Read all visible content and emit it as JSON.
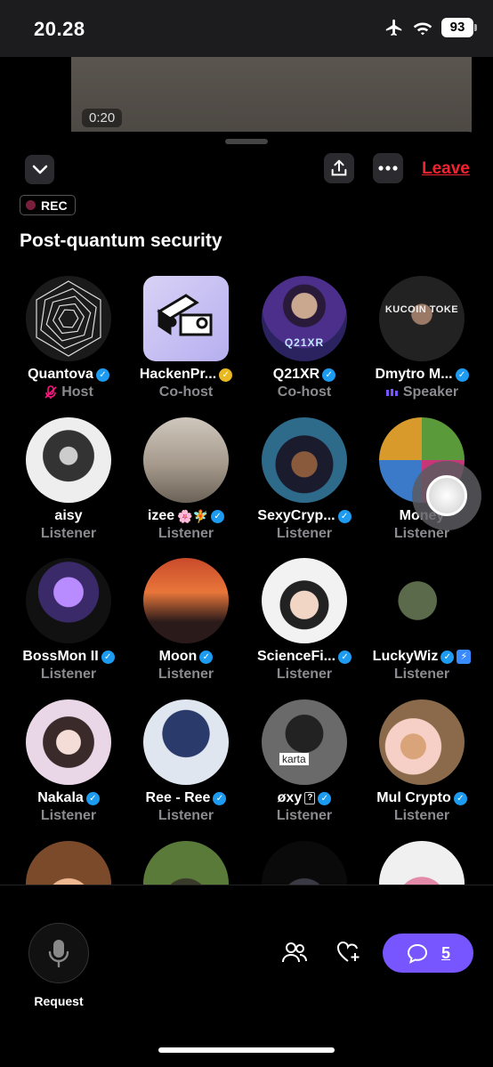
{
  "status_bar": {
    "time": "20.28",
    "battery": "93"
  },
  "video": {
    "time": "0:20"
  },
  "header": {
    "leave_label": "Leave",
    "rec_label": "REC"
  },
  "space": {
    "title": "Post-quantum security"
  },
  "participants": [
    {
      "name": "Quantova",
      "role": "Host",
      "verified": "blue",
      "role_icon": "muted-mic-icon"
    },
    {
      "name": "HackenPr...",
      "role": "Co-host",
      "verified": "gold"
    },
    {
      "name": "Q21XR",
      "role": "Co-host",
      "verified": "blue",
      "avatar_text": "Q21XR"
    },
    {
      "name": "Dmytro M...",
      "role": "Speaker",
      "verified": "blue",
      "role_icon": "speaking-bars-icon",
      "avatar_text": "KUCOIN TOKE"
    },
    {
      "name": "aisy",
      "role": "Listener"
    },
    {
      "name": "izee",
      "role": "Listener",
      "verified": "blue",
      "name_suffix": "🌸🧚"
    },
    {
      "name": "SexyCryp...",
      "role": "Listener",
      "verified": "blue"
    },
    {
      "name": "Money",
      "role": "Listener"
    },
    {
      "name": "BossMon II",
      "role": "Listener",
      "verified": "blue"
    },
    {
      "name": "Moon",
      "role": "Listener",
      "verified": "blue"
    },
    {
      "name": "ScienceFi...",
      "role": "Listener",
      "verified": "blue"
    },
    {
      "name": "LuckyWiz",
      "role": "Listener",
      "verified": "blue",
      "extra_badge": "⚡"
    },
    {
      "name": "Nakala",
      "role": "Listener",
      "verified": "blue"
    },
    {
      "name": "Ree - Ree",
      "role": "Listener",
      "verified": "blue"
    },
    {
      "name": "øxy",
      "role": "Listener",
      "verified": "blue",
      "name_suffix": "?",
      "avatar_text": "karta"
    },
    {
      "name": "Mul Crypto",
      "role": "Listener",
      "verified": "blue"
    }
  ],
  "bottom": {
    "request_label": "Request",
    "comment_count": "5"
  },
  "colors": {
    "accent": "#7856ff",
    "leave": "#f4212e",
    "verified": "#1d9bf0",
    "gold": "#e8b923",
    "speaker": "#7856ff"
  }
}
